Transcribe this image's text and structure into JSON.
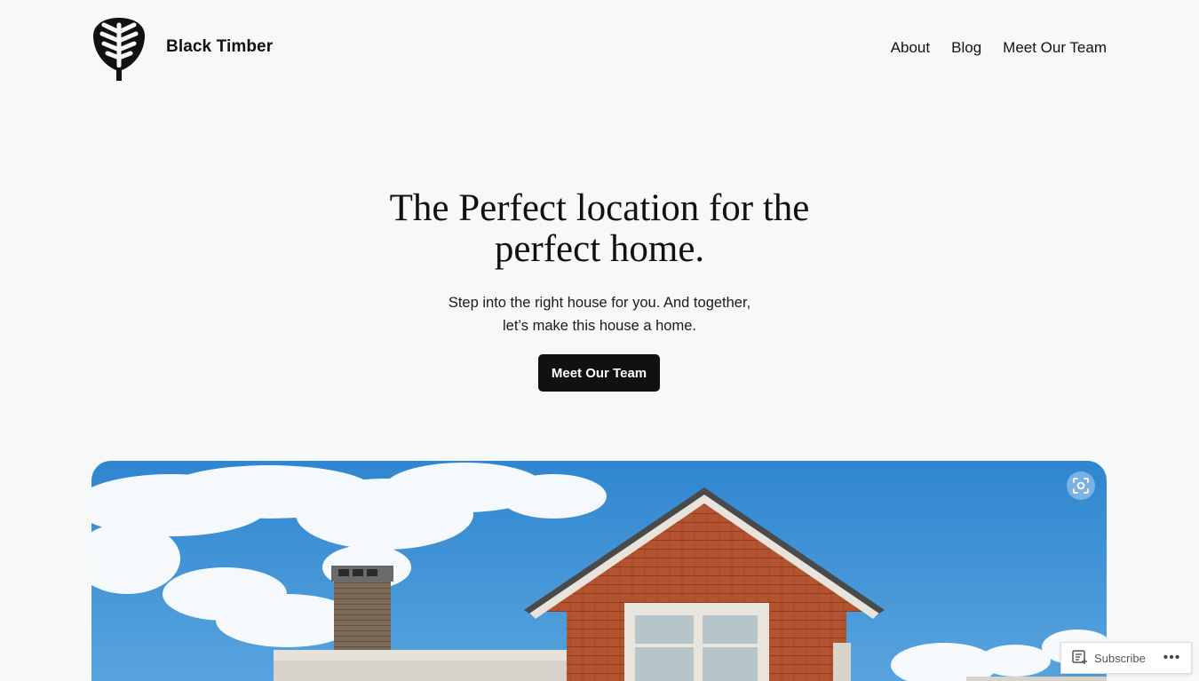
{
  "header": {
    "site_title": "Black Timber",
    "logo_icon": "tree-leaf-logo-icon"
  },
  "nav": {
    "items": [
      {
        "label": "About"
      },
      {
        "label": "Blog"
      },
      {
        "label": "Meet Our Team"
      }
    ]
  },
  "hero": {
    "title_line1": "The Perfect location for the",
    "title_line2": "perfect home.",
    "subtitle_line1": "Step into the right house for you. And together,",
    "subtitle_line2": "let’s make this house a home.",
    "cta_label": "Meet Our Team"
  },
  "image": {
    "lens_icon": "image-search-icon"
  },
  "subscribe_bar": {
    "subscribe_label": "Subscribe",
    "subscribe_icon": "reader-icon",
    "more_label": "•••",
    "more_icon": "ellipsis-icon"
  },
  "colors": {
    "background": "#f7f9f8",
    "text": "#111111",
    "button": "#111111",
    "sky": "#3a8ed3",
    "siding": "#b5532f"
  }
}
